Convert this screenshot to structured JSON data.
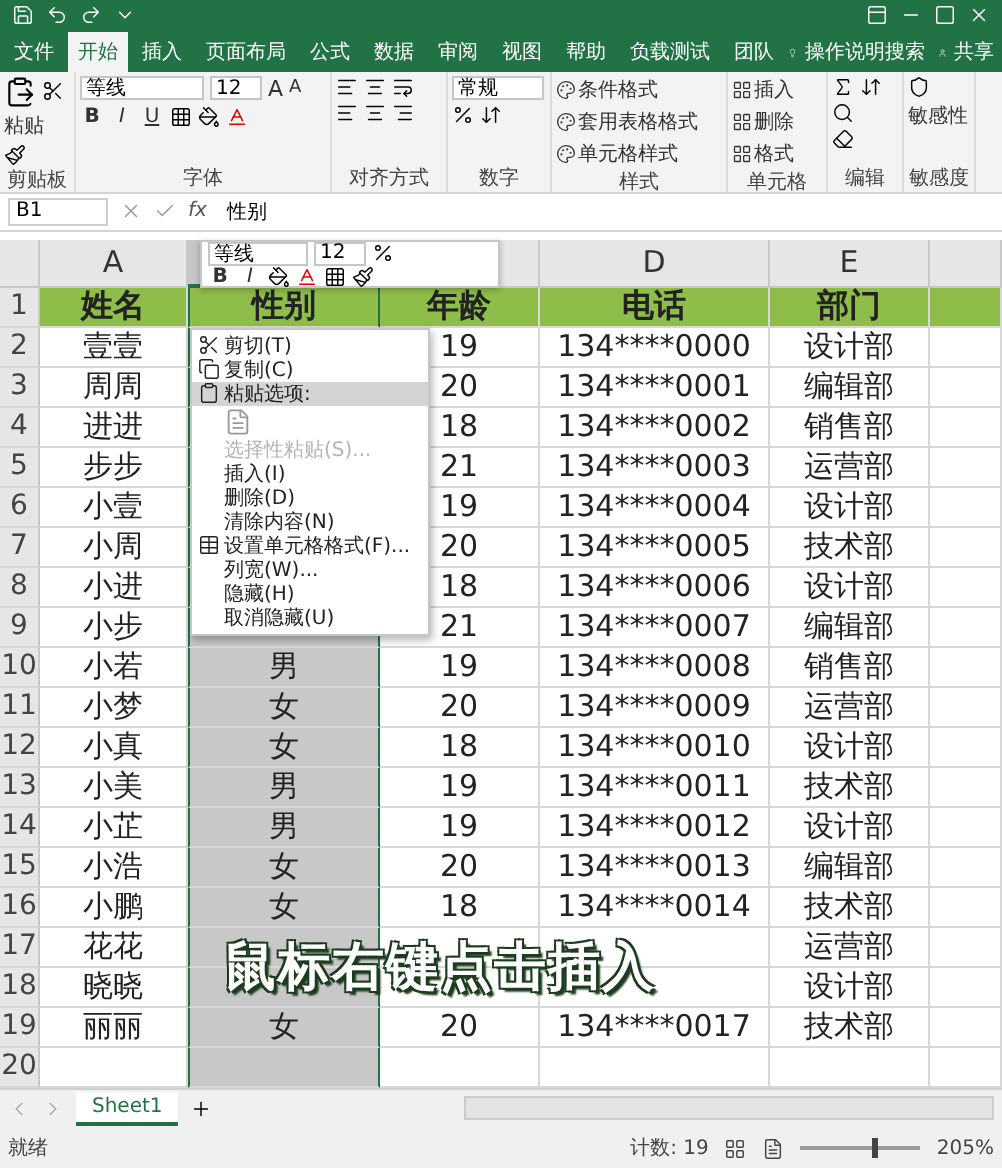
{
  "ribbon": {
    "tabs": [
      {
        "label": "文件",
        "selected": false
      },
      {
        "label": "开始",
        "selected": true
      },
      {
        "label": "插入",
        "selected": false
      },
      {
        "label": "页面布局",
        "selected": false
      },
      {
        "label": "公式",
        "selected": false
      },
      {
        "label": "数据",
        "selected": false
      },
      {
        "label": "审阅",
        "selected": false
      },
      {
        "label": "视图",
        "selected": false
      },
      {
        "label": "帮助",
        "selected": false
      },
      {
        "label": "负载测试",
        "selected": false
      },
      {
        "label": "团队",
        "selected": false
      }
    ],
    "search": "操作说明搜索",
    "share": "共享",
    "clipboard": {
      "paste": "粘贴",
      "label": "剪贴板"
    },
    "font": {
      "name": "等线",
      "size": "12",
      "resize": [
        "A",
        "A"
      ],
      "styles": [
        "B",
        "I",
        "U"
      ],
      "label": "字体"
    },
    "alignment": {
      "label": "对齐方式"
    },
    "number": {
      "format": "常规",
      "label": "数字"
    },
    "styles": {
      "items": [
        "条件格式",
        "套用表格格式",
        "单元格样式"
      ],
      "label": "样式"
    },
    "cells": {
      "items": [
        "插入",
        "删除",
        "格式"
      ],
      "label": "单元格"
    },
    "editing": {
      "label": "编辑"
    },
    "sensitivity": {
      "button": "敏感性",
      "label": "敏感度"
    }
  },
  "formula_bar": {
    "name_box": "B1",
    "fx": "fx",
    "content": "性别"
  },
  "columns": [
    {
      "letter": "A",
      "selected": false
    },
    {
      "selected": true
    },
    {
      "selected": false
    },
    {
      "letter": "D",
      "selected": false
    },
    {
      "letter": "E",
      "selected": false
    },
    {
      "selected": false
    }
  ],
  "header_row": {
    "number": "1",
    "cells": [
      "姓名",
      "性别",
      "年龄",
      "电话",
      "部门"
    ]
  },
  "rows": [
    {
      "number": "2",
      "cells": [
        "壹壹",
        null,
        "19",
        "134****0000",
        "设计部"
      ]
    },
    {
      "number": "3",
      "cells": [
        "周周",
        null,
        "20",
        "134****0001",
        "编辑部"
      ]
    },
    {
      "number": "4",
      "cells": [
        "进进",
        null,
        "18",
        "134****0002",
        "销售部"
      ]
    },
    {
      "number": "5",
      "cells": [
        "步步",
        null,
        "21",
        "134****0003",
        "运营部"
      ]
    },
    {
      "number": "6",
      "cells": [
        "小壹",
        null,
        "19",
        "134****0004",
        "设计部"
      ]
    },
    {
      "number": "7",
      "cells": [
        "小周",
        null,
        "20",
        "134****0005",
        "技术部"
      ]
    },
    {
      "number": "8",
      "cells": [
        "小进",
        null,
        "18",
        "134****0006",
        "设计部"
      ]
    },
    {
      "number": "9",
      "cells": [
        "小步",
        null,
        "21",
        "134****0007",
        "编辑部"
      ]
    },
    {
      "number": "10",
      "cells": [
        "小若",
        "男",
        "19",
        "134****0008",
        "销售部"
      ]
    },
    {
      "number": "11",
      "cells": [
        "小梦",
        "女",
        "20",
        "134****0009",
        "运营部"
      ]
    },
    {
      "number": "12",
      "cells": [
        "小真",
        "女",
        "18",
        "134****0010",
        "设计部"
      ]
    },
    {
      "number": "13",
      "cells": [
        "小美",
        "男",
        "19",
        "134****0011",
        "技术部"
      ]
    },
    {
      "number": "14",
      "cells": [
        "小芷",
        "男",
        "19",
        "134****0012",
        "设计部"
      ]
    },
    {
      "number": "15",
      "cells": [
        "小浩",
        "女",
        "20",
        "134****0013",
        "编辑部"
      ]
    },
    {
      "number": "16",
      "cells": [
        "小鹏",
        "女",
        "18",
        "134****0014",
        "技术部"
      ]
    },
    {
      "number": "17",
      "cells": [
        "花花",
        null,
        null,
        null,
        "运营部"
      ]
    },
    {
      "number": "18",
      "cells": [
        "晓晓",
        null,
        null,
        null,
        "设计部"
      ]
    },
    {
      "number": "19",
      "cells": [
        "丽丽",
        "女",
        "20",
        "134****0017",
        "技术部"
      ]
    },
    {
      "number": "20",
      "cells": [
        null,
        null,
        null,
        null,
        null
      ]
    }
  ],
  "mini_toolbar": {
    "font": "等线",
    "size": "12",
    "styles": [
      "B",
      "I"
    ]
  },
  "context_menu": [
    {
      "kind": "cut",
      "label": "剪切(T)",
      "highlighted": false,
      "disabled": false
    },
    {
      "kind": "copy",
      "label": "复制(C)",
      "highlighted": false,
      "disabled": false
    },
    {
      "kind": "paste",
      "label": "粘贴选项:",
      "highlighted": true,
      "disabled": false
    },
    {
      "kind": "paste-icon"
    },
    {
      "kind": "plain",
      "label": "选择性粘贴(S)...",
      "highlighted": false,
      "disabled": true
    },
    {
      "kind": "plain",
      "label": "插入(I)",
      "highlighted": false,
      "disabled": false
    },
    {
      "kind": "plain",
      "label": "删除(D)",
      "highlighted": false,
      "disabled": false
    },
    {
      "kind": "plain",
      "label": "清除内容(N)",
      "highlighted": false,
      "disabled": false
    },
    {
      "kind": "format",
      "label": "设置单元格格式(F)...",
      "highlighted": false,
      "disabled": false
    },
    {
      "kind": "plain",
      "label": "列宽(W)...",
      "highlighted": false,
      "disabled": false
    },
    {
      "kind": "plain",
      "label": "隐藏(H)",
      "highlighted": false,
      "disabled": false
    },
    {
      "kind": "plain",
      "label": "取消隐藏(U)",
      "highlighted": false,
      "disabled": false
    }
  ],
  "caption": "鼠标右键点击插入",
  "sheet_tabs": [
    {
      "label": "Sheet1",
      "selected": true
    }
  ],
  "status_bar": {
    "ready": "就绪",
    "count": "计数: 19",
    "zoom": {
      "level": 0.6,
      "reading": "205%"
    }
  }
}
